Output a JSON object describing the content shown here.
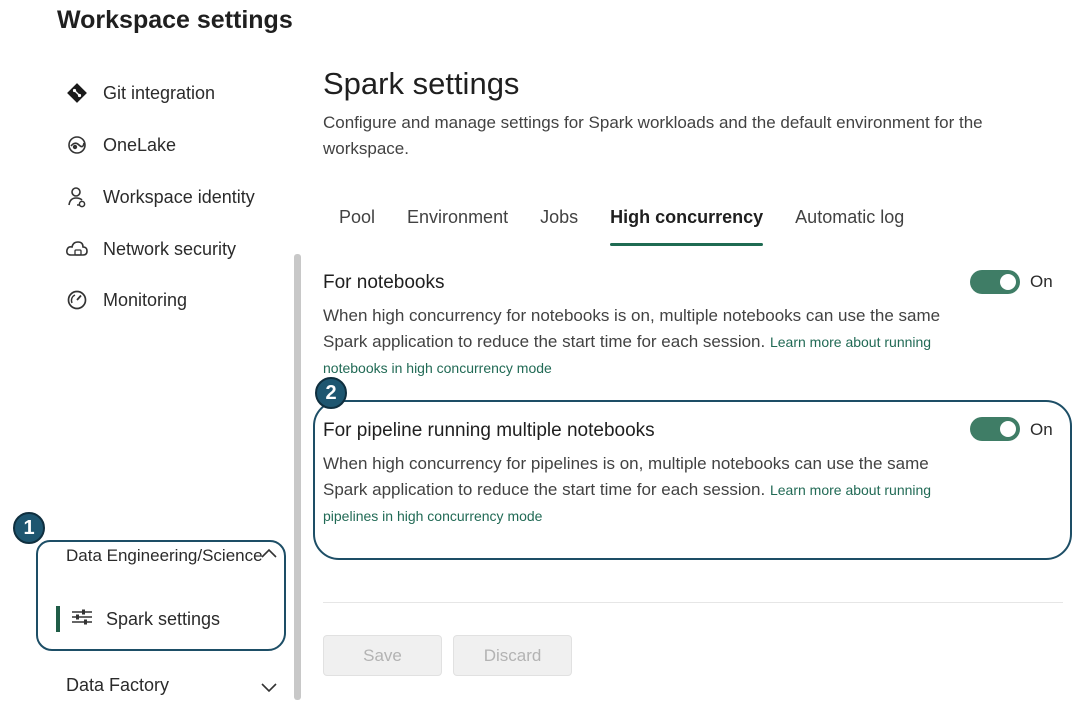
{
  "workspace_title": "Workspace settings",
  "sidebar": {
    "items": [
      {
        "label": "Git integration",
        "icon": "git-icon"
      },
      {
        "label": "OneLake",
        "icon": "onelake-icon"
      },
      {
        "label": "Workspace identity",
        "icon": "workspace-identity-icon"
      },
      {
        "label": "Network security",
        "icon": "network-security-icon"
      },
      {
        "label": "Monitoring",
        "icon": "monitoring-icon"
      }
    ],
    "data_engineering_group": {
      "label": "Data Engineering/Science",
      "expanded": true,
      "items": [
        {
          "label": "Spark settings",
          "icon": "sliders-icon",
          "selected": true
        }
      ]
    },
    "data_factory_group": {
      "label": "Data Factory",
      "expanded": false
    }
  },
  "callouts": {
    "one": "1",
    "two": "2"
  },
  "main": {
    "title": "Spark settings",
    "description": "Configure and manage settings for Spark workloads and the default environment for the workspace.",
    "tabs": [
      {
        "label": "Pool"
      },
      {
        "label": "Environment"
      },
      {
        "label": "Jobs"
      },
      {
        "label": "High concurrency",
        "active": true
      },
      {
        "label": "Automatic log"
      }
    ],
    "notebooks": {
      "title": "For notebooks",
      "description": "When high concurrency for notebooks is on, multiple notebooks can use the same Spark application to reduce the start time for each session.",
      "link": "Learn more about running notebooks in high concurrency mode",
      "toggle_label": "On",
      "enabled": true
    },
    "pipelines": {
      "title": "For pipeline running multiple notebooks",
      "description": "When high concurrency for pipelines is on, multiple notebooks can use the same Spark application to reduce the start time for each session.",
      "link": "Learn more about running pipelines in high concurrency mode",
      "toggle_label": "On",
      "enabled": true
    },
    "buttons": {
      "save": "Save",
      "discard": "Discard"
    }
  },
  "colors": {
    "accent": "#3f7d66",
    "callout": "#1e5670",
    "link": "#216a55"
  }
}
